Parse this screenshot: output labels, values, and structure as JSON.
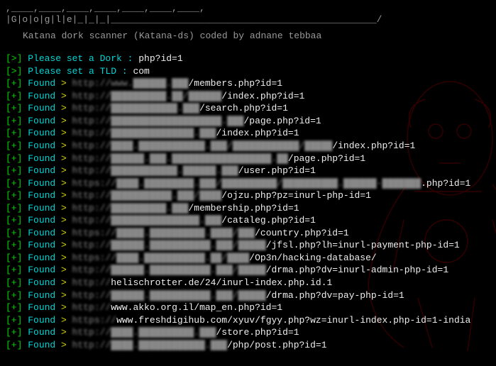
{
  "ascii": ",____,____,____,____,____,____,____,\n|G|o|o|g|l|e|_|_|_|________________________________________________/",
  "tagline": "Katana dork scanner (Katana-ds) coded by adnane tebbaa",
  "prompts": [
    {
      "marker": "[>]",
      "label": "Please set a Dork : ",
      "value": "php?id=1"
    },
    {
      "marker": "[>]",
      "label": "Please set a TLD : ",
      "value": "com"
    }
  ],
  "found_marker": "[+]",
  "found_label": "Found",
  "chevron": ">",
  "results": [
    {
      "blurred": "http://www.██████.███",
      "clear": "/members.php?id=1"
    },
    {
      "blurred": "http://██████████.██/██████",
      "clear": "/index.php?id=1"
    },
    {
      "blurred": "http://████████████.███",
      "clear": "/search.php?id=1"
    },
    {
      "blurred": "http://████████████████████.███",
      "clear": "/page.php?id=1"
    },
    {
      "blurred": "http://███████████████.███",
      "clear": "/index.php?id=1"
    },
    {
      "blurred": "http://████.████████████.███/████████████/█████",
      "clear": "/index.php?id=1"
    },
    {
      "blurred": "http://██████.███.██████████████████.██",
      "clear": "/page.php?id=1"
    },
    {
      "blurred": "http://████████████.██████.███",
      "clear": "/user.php?id=1"
    },
    {
      "blurred": "https://████.█████████.███/██████████/██████████.██████-███████",
      "clear": ".php?id=1"
    },
    {
      "blurred": "http://███████████.███/████",
      "clear": "/ojzu.php?pz=inurl-php-id=1"
    },
    {
      "blurred": "http://██████████.███",
      "clear": "/membership.php?id=1"
    },
    {
      "blurred": "http://████████████████.███",
      "clear": "/cataleg.php?id=1"
    },
    {
      "blurred": "https://█████.██████████.████/███",
      "clear": "/country.php?id=1"
    },
    {
      "blurred": "http://██████.███████████.███/█████",
      "clear": "/jfsl.php?lh=inurl-payment-php-id=1"
    },
    {
      "blurred": "https://████.███████████.██/████",
      "clear": "/Op3n/hacking-database/"
    },
    {
      "blurred": "http://██████.███████████.███/█████",
      "clear": "/drma.php?dv=inurl-admin-php-id=1"
    },
    {
      "blurred": "http://",
      "clear": "helischrotter.de/24/inurl-index.php.id.1"
    },
    {
      "blurred": "http://██████.███████████.███/█████",
      "clear": "/drma.php?dv=pay-php-id=1"
    },
    {
      "blurred": "http://",
      "clear": "www.akko.org.il/map_en.php?id=1"
    },
    {
      "blurred": "https://",
      "clear": "www.freshdigihub.com/xyuv/fgyy.php?wz=inurl-index.php-id=1-india"
    },
    {
      "blurred": "http://████.██████████.███",
      "clear": "/store.php?id=1"
    },
    {
      "blurred": "http://████.████████████.███",
      "clear": "/php/post.php?id=1"
    }
  ]
}
